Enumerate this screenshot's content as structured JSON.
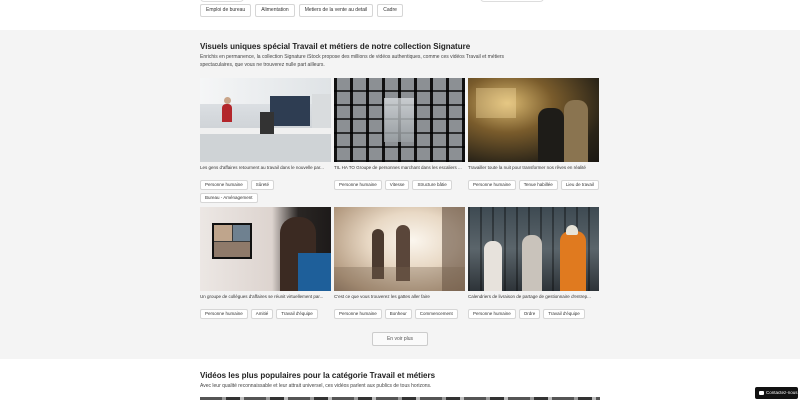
{
  "top_tags": [
    "Emploi de bureau",
    "Alimentation",
    "Metiers de la vente au detail",
    "Cadre"
  ],
  "signature": {
    "title": "Visuels uniques spécial Travail et métiers de notre collection Signature",
    "description": "Enrichis en permanence, la collection Signature iStock propose des millions de vidéos authentiques, comme ces vidéos Travail et métiers spectaculaires, que vous ne trouverez nulle part ailleurs.",
    "cards": [
      {
        "caption": "Les gens d'affaires retournent au travail dans le nouvelle par...",
        "tags": [
          "Personne humaine",
          "Sûreté",
          "Bureau - Aménagement"
        ]
      },
      {
        "caption": "TIL HA TO Groupe de personnes marchant dans les escaliers ...",
        "tags": [
          "Personne humaine",
          "Vitesse",
          "Structure bâtie"
        ]
      },
      {
        "caption": "Travailler toute la nuit pour transformer nos rêves en réalité",
        "tags": [
          "Personne humaine",
          "Tenue habillée",
          "Lieu de travail"
        ]
      },
      {
        "caption": "Un groupe de collègues d'affaires se réunit virtuellement par...",
        "tags": [
          "Personne humaine",
          "Amitié",
          "Travail d'équipe"
        ]
      },
      {
        "caption": "C'est ce que vous trouverez les gattes aller faire",
        "tags": [
          "Personne humaine",
          "Bonheur",
          "Commencement"
        ]
      },
      {
        "caption": "Calendriers de livraison de partage de gestionnaire d'entrep...",
        "tags": [
          "Personne humaine",
          "Ordre",
          "Travail d'équipe"
        ]
      }
    ],
    "see_more": "En voir plus"
  },
  "popular": {
    "title": "Vidéos les plus populaires pour la catégorie Travail et métiers",
    "description": "Avec leur qualité reconnaissable et leur attrait universel, ces vidéos parlent aux publics de tous horizons."
  },
  "contact_label": "Contactez-nous",
  "colors": {
    "section_bg": "#f4f4f4",
    "contact_bg": "#111111"
  }
}
